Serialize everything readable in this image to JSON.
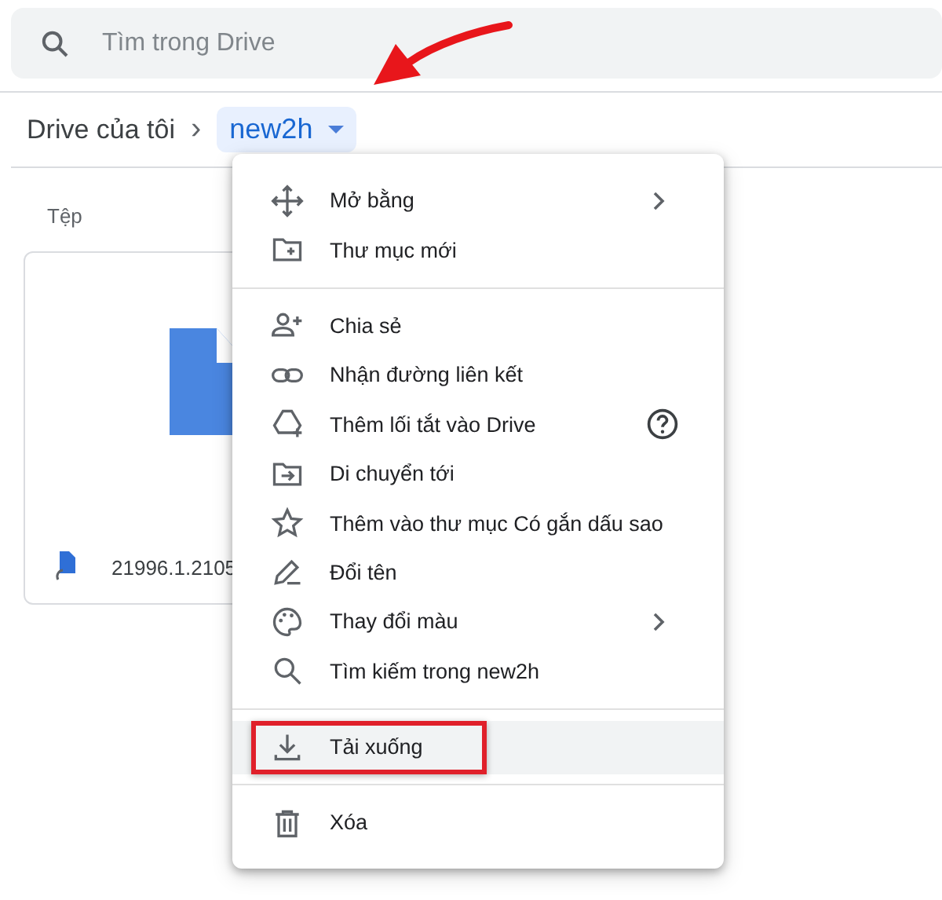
{
  "search": {
    "placeholder": "Tìm trong Drive"
  },
  "breadcrumb": {
    "root": "Drive của tôi",
    "separator": "›",
    "current": "new2h"
  },
  "files": {
    "heading": "Tệp",
    "items": [
      {
        "name": "21996.1.2105"
      }
    ]
  },
  "menu": {
    "groups": [
      [
        {
          "label": "Mở bằng",
          "submenu": true,
          "help": false,
          "highlighted": false
        },
        {
          "label": "Thư mục mới",
          "submenu": false,
          "help": false,
          "highlighted": false
        }
      ],
      [
        {
          "label": "Chia sẻ",
          "submenu": false,
          "help": false,
          "highlighted": false
        },
        {
          "label": "Nhận đường liên kết",
          "submenu": false,
          "help": false,
          "highlighted": false
        },
        {
          "label": "Thêm lối tắt vào Drive",
          "submenu": false,
          "help": true,
          "highlighted": false
        },
        {
          "label": "Di chuyển tới",
          "submenu": false,
          "help": false,
          "highlighted": false
        },
        {
          "label": "Thêm vào thư mục Có gắn dấu sao",
          "submenu": false,
          "help": false,
          "highlighted": false
        },
        {
          "label": "Đổi tên",
          "submenu": false,
          "help": false,
          "highlighted": false
        },
        {
          "label": "Thay đổi màu",
          "submenu": true,
          "help": false,
          "highlighted": false
        },
        {
          "label": "Tìm kiếm trong new2h",
          "submenu": false,
          "help": false,
          "highlighted": false
        }
      ],
      [
        {
          "label": "Tải xuống",
          "submenu": false,
          "help": false,
          "highlighted": true
        }
      ],
      [
        {
          "label": "Xóa",
          "submenu": false,
          "help": false,
          "highlighted": false
        }
      ]
    ]
  }
}
